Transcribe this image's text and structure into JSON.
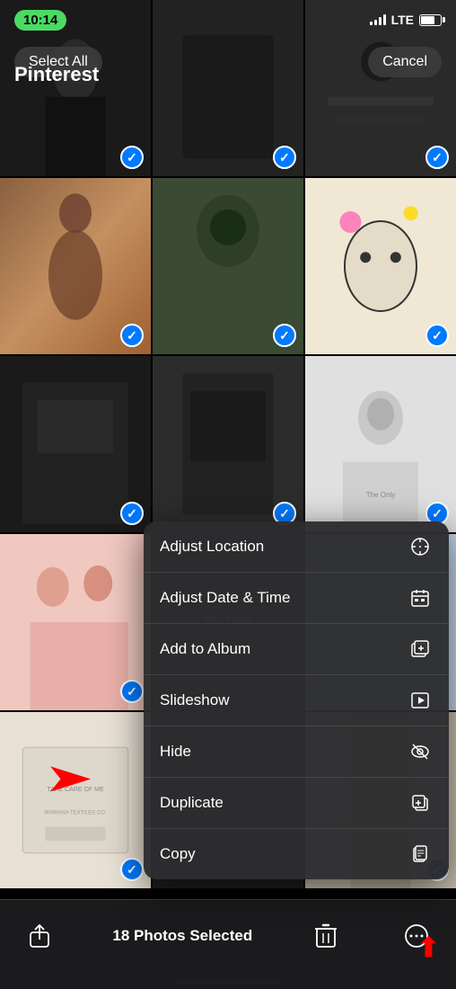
{
  "statusBar": {
    "time": "10:14",
    "carrier": "LTE"
  },
  "topBar": {
    "selectAllLabel": "Select All",
    "cancelLabel": "Cancel",
    "titleLabel": "Pinterest"
  },
  "photos": {
    "selectedCount": 18,
    "selectedText": "18 Photos Selected"
  },
  "contextMenu": {
    "items": [
      {
        "id": "adjust-location",
        "label": "Adjust Location",
        "icon": "ℹ"
      },
      {
        "id": "adjust-date-time",
        "label": "Adjust Date & Time",
        "icon": "📅"
      },
      {
        "id": "add-to-album",
        "label": "Add to Album",
        "icon": "🗂"
      },
      {
        "id": "slideshow",
        "label": "Slideshow",
        "icon": "▶"
      },
      {
        "id": "hide",
        "label": "Hide",
        "icon": "👁"
      },
      {
        "id": "duplicate",
        "label": "Duplicate",
        "icon": "⧉"
      },
      {
        "id": "copy",
        "label": "Copy",
        "icon": "📋"
      }
    ]
  },
  "toolbar": {
    "shareLabel": "share",
    "deleteLabel": "delete",
    "moreLabel": "more"
  }
}
